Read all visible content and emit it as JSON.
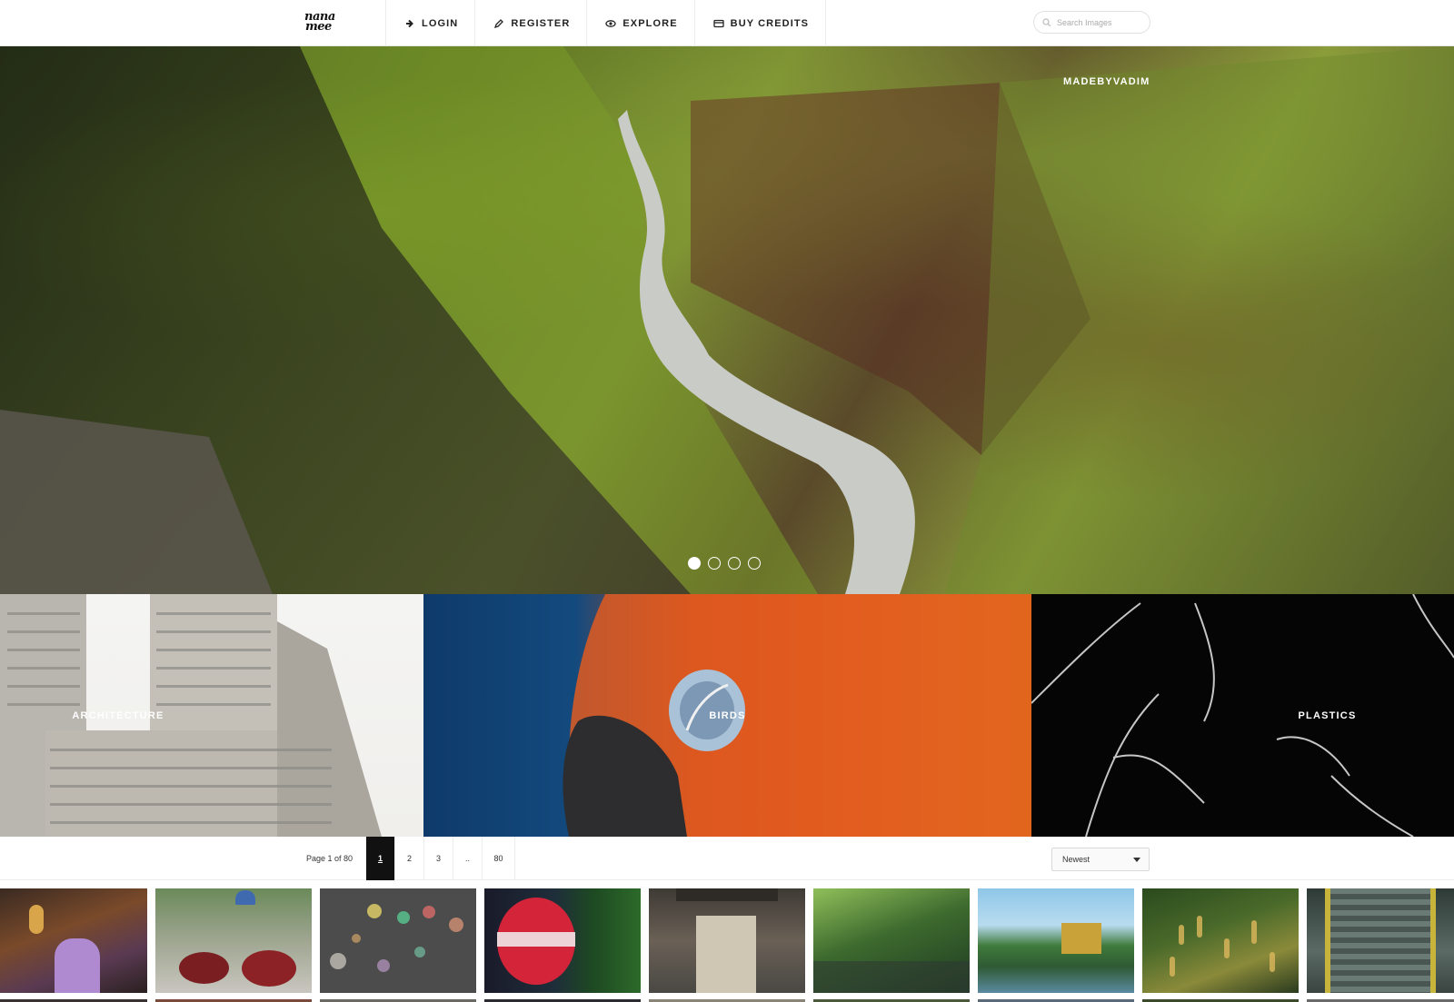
{
  "brand": {
    "logo_line1": "nana",
    "logo_line2": "mee"
  },
  "nav": [
    {
      "label": "LOGIN",
      "icon": "arrow-right-icon"
    },
    {
      "label": "REGISTER",
      "icon": "pencil-icon"
    },
    {
      "label": "EXPLORE",
      "icon": "eye-icon"
    },
    {
      "label": "BUY CREDITS",
      "icon": "credit-card-icon"
    }
  ],
  "search": {
    "placeholder": "Search Images"
  },
  "hero": {
    "credit": "MADEBYVADIM",
    "slides": 4,
    "active_slide": 1
  },
  "categories": [
    {
      "label": "ARCHITECTURE"
    },
    {
      "label": "BIRDS"
    },
    {
      "label": "PLASTICS"
    }
  ],
  "pager": {
    "summary": "Page 1 of 80",
    "pages": [
      "1",
      "2",
      "3",
      "..",
      "80"
    ],
    "current": "1"
  },
  "sort": {
    "selected": "Newest"
  },
  "colors": {
    "text": "#222222",
    "divider": "#ececec",
    "active_page": "#111111"
  }
}
